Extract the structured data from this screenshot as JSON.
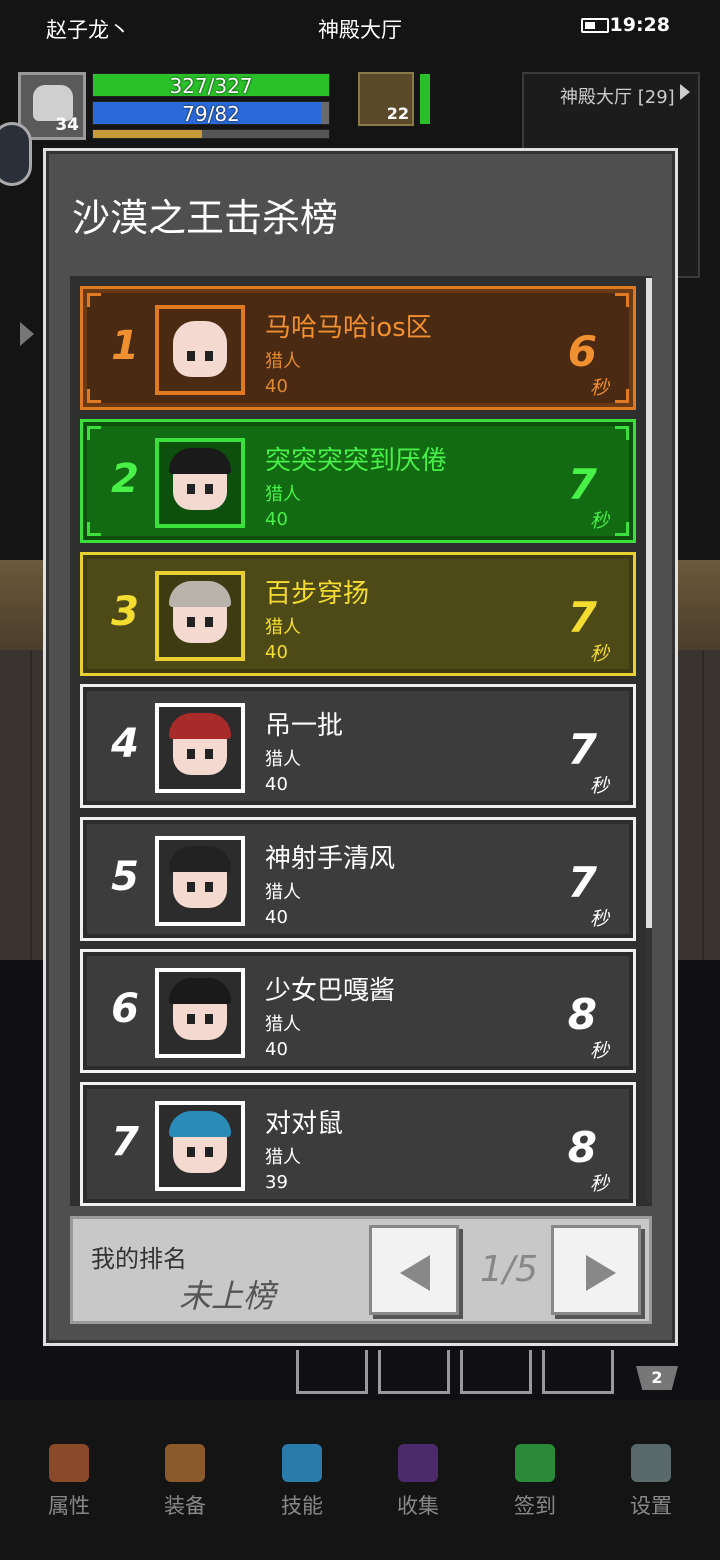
{
  "status_bar": {
    "user": "赵子龙丶",
    "location": "神殿大厅",
    "time": "19:28"
  },
  "hud": {
    "player_level": "34",
    "hp_text": "327/327",
    "mp_text": "79/82",
    "xp_fraction": 0.46,
    "pet_level": "22",
    "minimap_title": "神殿大厅 [29]"
  },
  "leaderboard": {
    "title": "沙漠之王击杀榜",
    "rows": [
      {
        "rank": "1",
        "name": "马哈马哈ios区",
        "class": "猎人",
        "level": "40",
        "time": "6",
        "unit": "秒"
      },
      {
        "rank": "2",
        "name": "突突突突到厌倦",
        "class": "猎人",
        "level": "40",
        "time": "7",
        "unit": "秒"
      },
      {
        "rank": "3",
        "name": "百步穿扬",
        "class": "猎人",
        "level": "40",
        "time": "7",
        "unit": "秒"
      },
      {
        "rank": "4",
        "name": "吊一批",
        "class": "猎人",
        "level": "40",
        "time": "7",
        "unit": "秒"
      },
      {
        "rank": "5",
        "name": "神射手清风",
        "class": "猎人",
        "level": "40",
        "time": "7",
        "unit": "秒"
      },
      {
        "rank": "6",
        "name": "少女巴嘎酱",
        "class": "猎人",
        "level": "40",
        "time": "8",
        "unit": "秒"
      },
      {
        "rank": "7",
        "name": "对对鼠",
        "class": "猎人",
        "level": "39",
        "time": "8",
        "unit": "秒"
      }
    ],
    "my_rank_label": "我的排名",
    "my_rank_value": "未上榜",
    "page": "1/5"
  },
  "badge_count": "2",
  "nav": [
    {
      "label": "属性",
      "icon": "helmet-icon",
      "color": "#8a4a2a"
    },
    {
      "label": "装备",
      "icon": "bag-icon",
      "color": "#8a5a2a"
    },
    {
      "label": "技能",
      "icon": "skill-orb-icon",
      "color": "#2a7aaa"
    },
    {
      "label": "收集",
      "icon": "book-icon",
      "color": "#4a2a6a"
    },
    {
      "label": "签到",
      "icon": "gem-icon",
      "color": "#2a8a3a"
    },
    {
      "label": "设置",
      "icon": "gear-icon",
      "color": "#5a6a6a"
    }
  ]
}
